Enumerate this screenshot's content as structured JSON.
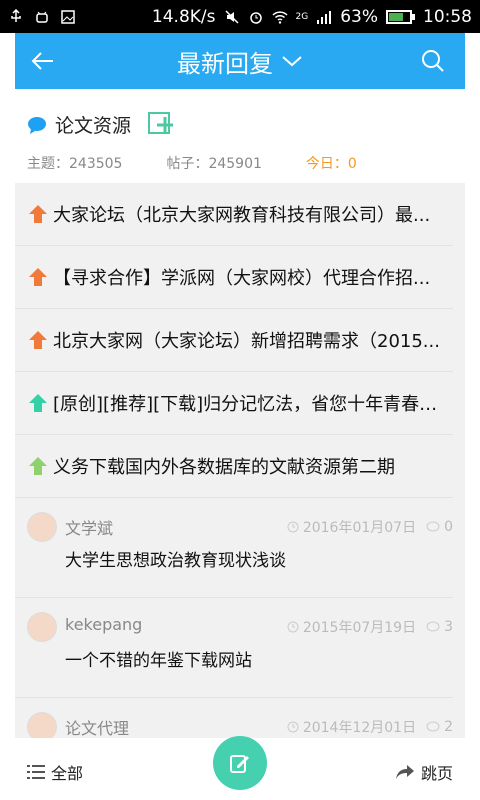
{
  "status": {
    "speed": "14.8K/s",
    "network": "2G",
    "battery": "63%",
    "time": "10:58"
  },
  "appbar": {
    "title": "最新回复",
    "title_icon": "chevron-down-icon"
  },
  "forum": {
    "name": "论文资源",
    "stats": {
      "topics_label": "主题：243505",
      "posts_label": "帖子：245901",
      "today_label": "今日：0"
    }
  },
  "threads": [
    {
      "title": "大家论坛（北京大家网教育科技有限公司）最...",
      "arrow_color": "#f07a3a"
    },
    {
      "title": "【寻求合作】学派网（大家网校）代理合作招...",
      "arrow_color": "#f07a3a"
    },
    {
      "title": "北京大家网（大家论坛）新增招聘需求（2015...",
      "arrow_color": "#f07a3a"
    },
    {
      "title": "[原创][推荐][下载]归分记忆法，省您十年青春！...",
      "arrow_color": "#34d0a6"
    },
    {
      "title": "义务下载国内外各数据库的文献资源第二期",
      "arrow_color": "#8fd16c"
    }
  ],
  "posts": [
    {
      "author": "文学斌",
      "date": "2016年01月07日",
      "replies": "0",
      "title": "大学生思想政治教育现状浅谈"
    },
    {
      "author": "kekepang",
      "date": "2015年07月19日",
      "replies": "3",
      "title": "一个不错的年鉴下载网站"
    },
    {
      "author": "论文代理",
      "date": "2014年12月01日",
      "replies": "2",
      "title": ""
    }
  ],
  "bottom": {
    "all_label": "全部",
    "jump_label": "跳页"
  }
}
